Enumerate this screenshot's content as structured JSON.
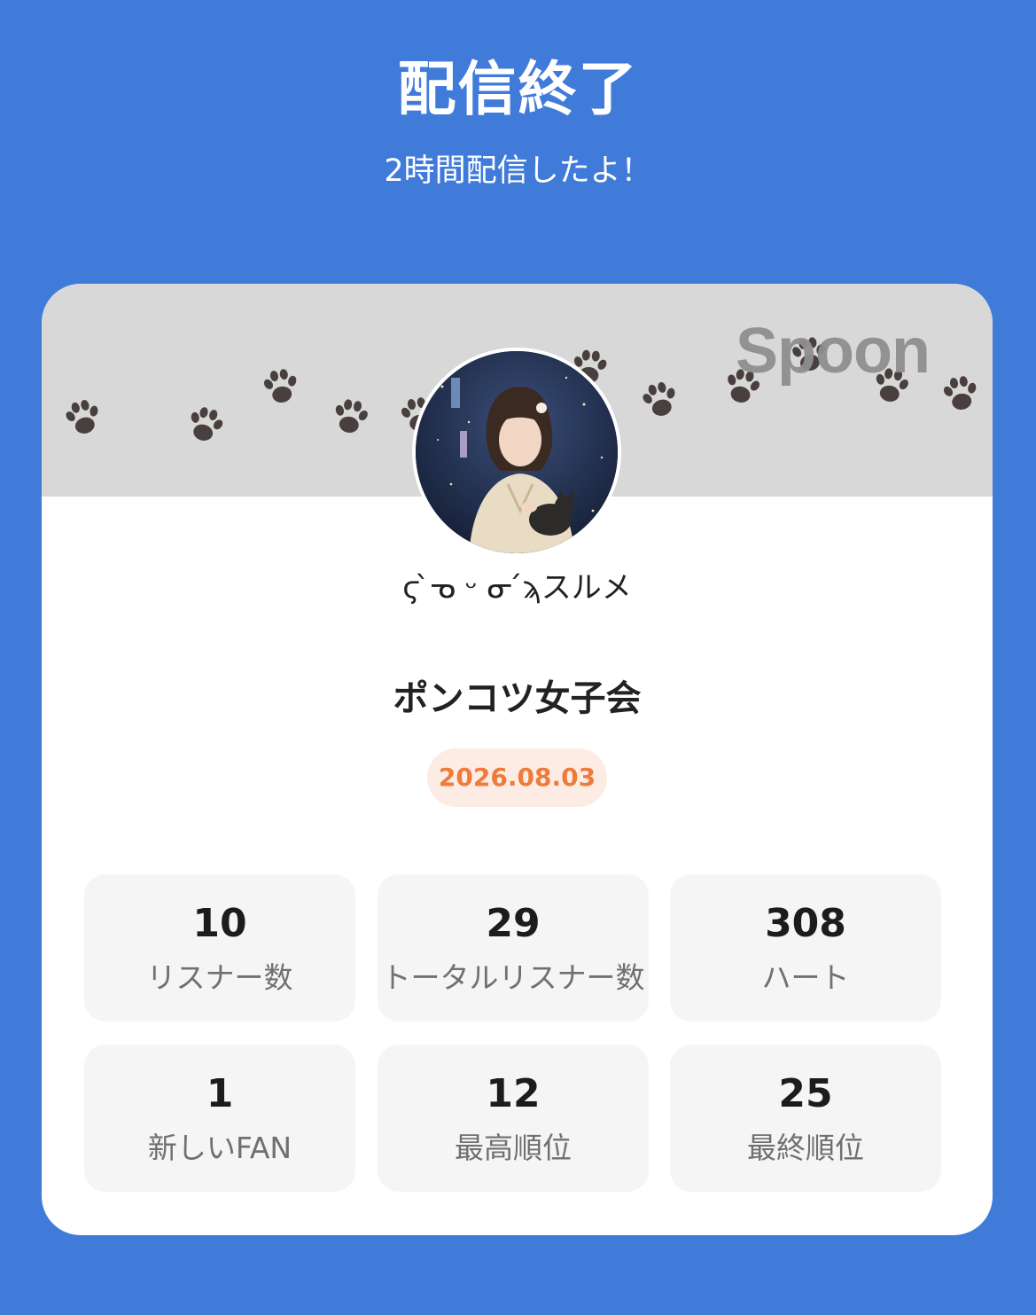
{
  "header": {
    "title": "配信終了",
    "subtitle": "2時間配信したよ！"
  },
  "card": {
    "brand": "Spoon",
    "banner_icon": "paw-print-icon",
    "colors": {
      "background": "#417bda",
      "banner": "#d8d8d8",
      "paw": "#4a3f3f",
      "date_text": "#ef7a3a",
      "date_bg": "#fcece3"
    },
    "nickname": "ϛ ̀ᓀ ᵕ ᓂ ́ϡスルメ",
    "room_title": "ポンコツ女子会",
    "date": "2026.08.03"
  },
  "stats": [
    {
      "value": "10",
      "label": "リスナー数"
    },
    {
      "value": "29",
      "label": "トータルリスナー数"
    },
    {
      "value": "308",
      "label": "ハート"
    },
    {
      "value": "1",
      "label": "新しいFAN"
    },
    {
      "value": "12",
      "label": "最高順位"
    },
    {
      "value": "25",
      "label": "最終順位"
    }
  ]
}
